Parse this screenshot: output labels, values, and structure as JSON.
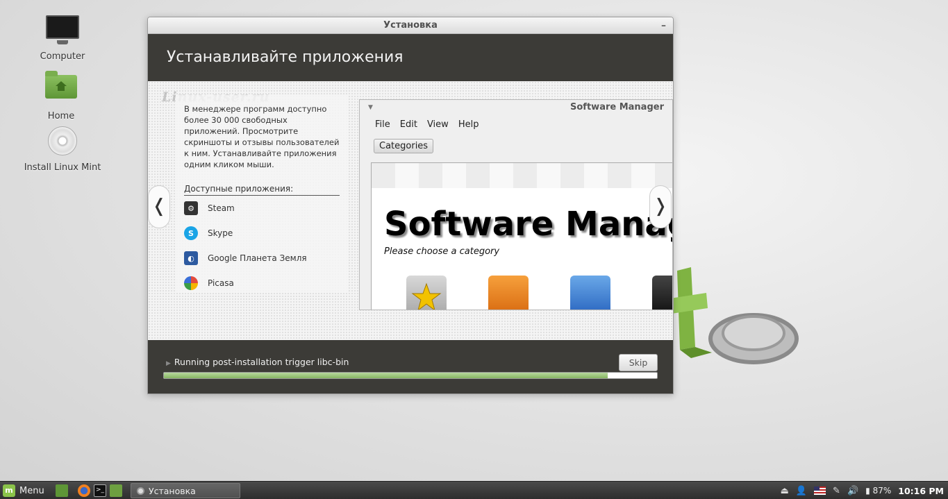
{
  "desktop": {
    "icons": [
      {
        "label": "Computer",
        "icon": "computer-icon"
      },
      {
        "label": "Home",
        "icon": "home-folder-icon"
      },
      {
        "label": "Install Linux Mint",
        "icon": "cd-icon"
      }
    ]
  },
  "window": {
    "title": "Установка",
    "minimize_glyph": "–",
    "header": "Устанавливайте приложения",
    "watermark": "Linux-user.ru",
    "description": "В менеджере программ доступно более 30 000 свободных приложений. Просмотрите скриншоты и отзывы пользователей к ним. Устанавливайте приложения одним кликом мыши.",
    "apps_title": "Доступные приложения:",
    "apps": [
      {
        "name": "Steam",
        "icon": "steam-icon",
        "color": "#333333"
      },
      {
        "name": "Skype",
        "icon": "skype-icon",
        "color": "#1aa4e6"
      },
      {
        "name": "Google Планета Земля",
        "icon": "google-earth-icon",
        "color": "#2d5aa0"
      },
      {
        "name": "Picasa",
        "icon": "picasa-icon",
        "color": "#e34b3c"
      }
    ],
    "nav_prev": "❬",
    "nav_next": "❭",
    "status_text": "Running post-installation trigger libc-bin",
    "progress": 0.9,
    "skip_label": "Skip"
  },
  "software_manager": {
    "title": "Software Manager",
    "menu": [
      "File",
      "Edit",
      "View",
      "Help"
    ],
    "categories_button": "Categories",
    "big_title": "Software Manager",
    "subtitle": "Please choose a category"
  },
  "taskbar": {
    "menu_label": "Menu",
    "task_label": "Установка",
    "battery": "87%",
    "clock": "10:16 PM"
  },
  "colors": {
    "header_bg": "#3c3b37",
    "progress": "#9ec77e",
    "mint_green": "#8bc34a"
  }
}
